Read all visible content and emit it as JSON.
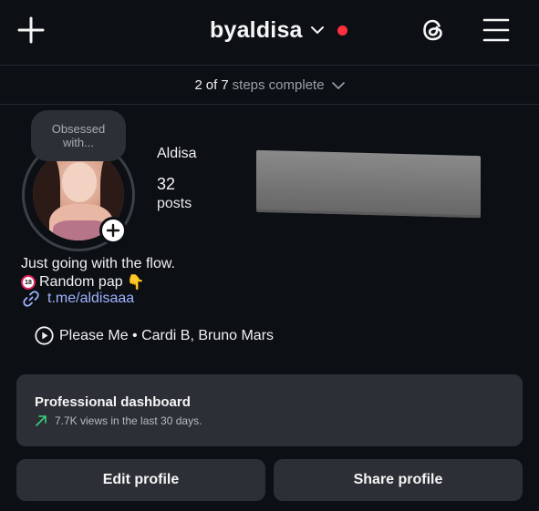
{
  "header": {
    "username": "byaldisa",
    "icons": [
      "plus-icon",
      "chevron-down-icon",
      "notification-dot",
      "threads-icon",
      "hamburger-menu-icon"
    ],
    "accent_red": "#ff3040"
  },
  "steps": {
    "count_done": "2",
    "of": "of",
    "count_total": "7",
    "suffix": "steps complete"
  },
  "profile": {
    "note_line1": "Obsessed",
    "note_line2": "with...",
    "display_name": "Aldisa",
    "posts_count": "32",
    "posts_label": "posts"
  },
  "bio": {
    "line1": "Just going with the flow.",
    "line2_text": "Random pap",
    "line2_badge": "18",
    "line2_emoji": "👇",
    "link": "t.me/aldisaaa",
    "link_color": "#9fb3ff"
  },
  "music": {
    "song": "Please Me • Cardi B, Bruno Mars"
  },
  "dashboard": {
    "title": "Professional dashboard",
    "subtitle": "7.7K views in the last 30 days.",
    "trend_color": "#3ad07a"
  },
  "buttons": {
    "edit": "Edit profile",
    "share": "Share profile"
  }
}
